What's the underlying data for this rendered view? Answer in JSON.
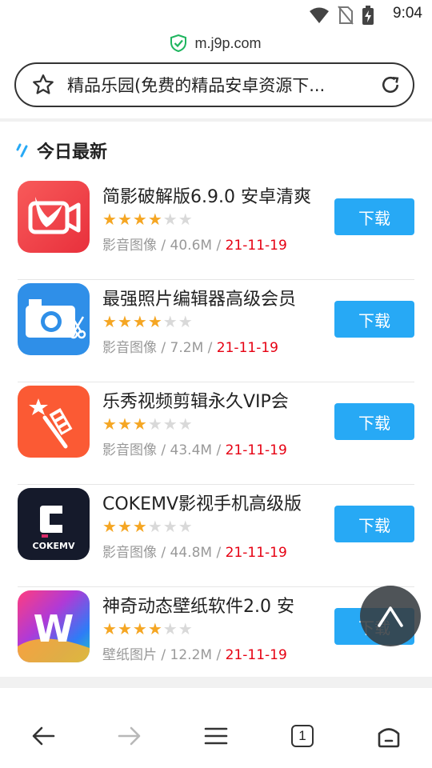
{
  "status": {
    "time": "9:04"
  },
  "browser": {
    "url": "m.j9p.com",
    "page_title": "精品乐园(免费的精品安卓资源下...",
    "tab_count": "1"
  },
  "section": {
    "title": "今日最新"
  },
  "apps": [
    {
      "name": "简影破解版6.9.0 安卓清爽",
      "rating": 4,
      "category": "影音图像",
      "size": "40.6M",
      "date": "21-11-19",
      "button": "下载"
    },
    {
      "name": "最强照片编辑器高级会员",
      "rating": 4,
      "category": "影音图像",
      "size": "7.2M",
      "date": "21-11-19",
      "button": "下载"
    },
    {
      "name": "乐秀视频剪辑永久VIP会",
      "rating": 3,
      "category": "影音图像",
      "size": "43.4M",
      "date": "21-11-19",
      "button": "下载"
    },
    {
      "name": "COKEMV影视手机高级版",
      "rating": 3,
      "category": "影音图像",
      "size": "44.8M",
      "date": "21-11-19",
      "button": "下载"
    },
    {
      "name": "神奇动态壁纸软件2.0 安",
      "rating": 4,
      "category": "壁纸图片",
      "size": "12.2M",
      "date": "21-11-19",
      "button": "下载"
    }
  ],
  "icons": {
    "app_icons": [
      "jianying-bird-icon",
      "camera-scissors-icon",
      "star-film-icon",
      "cokemv-logo-icon",
      "w-wallpaper-icon"
    ],
    "app_icon_colors": [
      "#f2434f",
      "#2f8fe8",
      "#fb5a34",
      "#151a2b",
      "#8d3ad6"
    ],
    "app_icon_text": [
      "",
      "",
      "",
      "COKEMV",
      "W"
    ]
  },
  "colors": {
    "accent": "#27a9f5",
    "date": "#e60012",
    "star": "#f5a623"
  }
}
